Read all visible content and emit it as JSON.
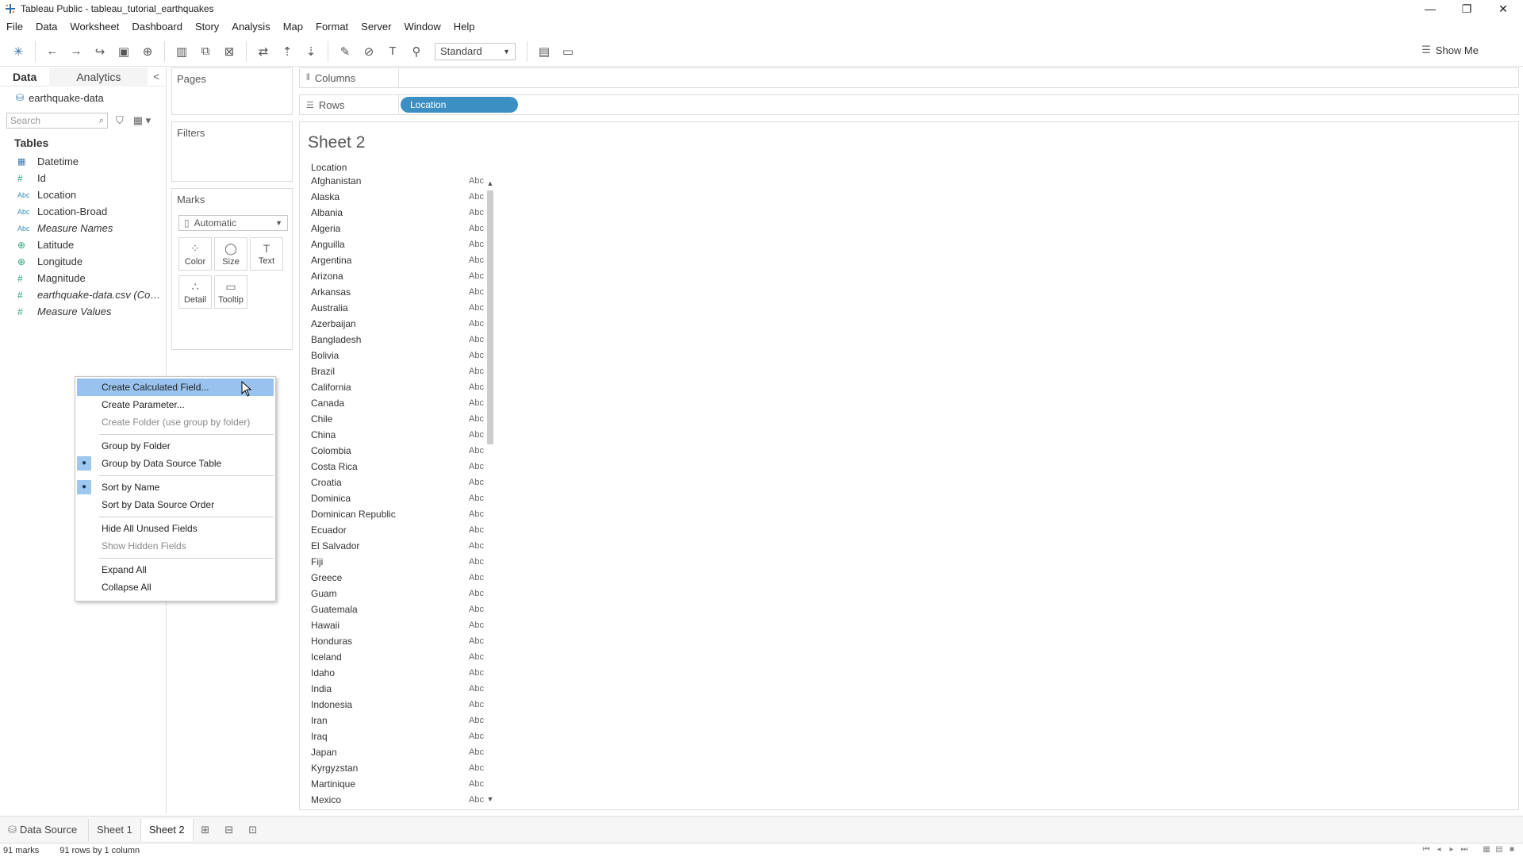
{
  "window": {
    "title": "Tableau Public - tableau_tutorial_earthquakes",
    "minimize": "—",
    "restore": "❐",
    "close": "✕"
  },
  "menu": [
    "File",
    "Data",
    "Worksheet",
    "Dashboard",
    "Story",
    "Analysis",
    "Map",
    "Format",
    "Server",
    "Window",
    "Help"
  ],
  "toolbar": {
    "fit_select": "Standard",
    "show_me": "Show Me"
  },
  "data_pane": {
    "tab_data": "Data",
    "tab_analytics": "Analytics",
    "collapse": "<",
    "datasource": "earthquake-data",
    "search_placeholder": "Search",
    "tables_header": "Tables",
    "fields": [
      {
        "type": "date",
        "glyph": "▦",
        "name": "Datetime",
        "italic": false
      },
      {
        "type": "num",
        "glyph": "#",
        "name": "Id",
        "italic": false
      },
      {
        "type": "str",
        "glyph": "Abc",
        "name": "Location",
        "italic": false
      },
      {
        "type": "str",
        "glyph": "Abc",
        "name": "Location-Broad",
        "italic": false
      },
      {
        "type": "str",
        "glyph": "Abc",
        "name": "Measure Names",
        "italic": true
      },
      {
        "type": "geo",
        "glyph": "⊕",
        "name": "Latitude",
        "italic": false
      },
      {
        "type": "geo",
        "glyph": "⊕",
        "name": "Longitude",
        "italic": false
      },
      {
        "type": "num",
        "glyph": "#",
        "name": "Magnitude",
        "italic": false
      },
      {
        "type": "num",
        "glyph": "#",
        "name": "earthquake-data.csv (Cou...",
        "italic": true
      },
      {
        "type": "num",
        "glyph": "#",
        "name": "Measure Values",
        "italic": true
      }
    ]
  },
  "cards": {
    "pages": "Pages",
    "filters": "Filters",
    "marks": "Marks",
    "marks_type": "Automatic",
    "mark_buttons": [
      {
        "label": "Color",
        "glyph": "⁘"
      },
      {
        "label": "Size",
        "glyph": "◯"
      },
      {
        "label": "Text",
        "glyph": "T"
      },
      {
        "label": "Detail",
        "glyph": "∴"
      },
      {
        "label": "Tooltip",
        "glyph": "▭"
      }
    ]
  },
  "shelves": {
    "columns": "Columns",
    "rows": "Rows",
    "rows_pill": "Location"
  },
  "view": {
    "sheet_title": "Sheet 2",
    "column_header": "Location",
    "abc": "Abc",
    "locations": [
      "Afghanistan",
      "Alaska",
      "Albania",
      "Algeria",
      "Anguilla",
      "Argentina",
      "Arizona",
      "Arkansas",
      "Australia",
      "Azerbaijan",
      "Bangladesh",
      "Bolivia",
      "Brazil",
      "California",
      "Canada",
      "Chile",
      "China",
      "Colombia",
      "Costa Rica",
      "Croatia",
      "Dominica",
      "Dominican Republic",
      "Ecuador",
      "El Salvador",
      "Fiji",
      "Greece",
      "Guam",
      "Guatemala",
      "Hawaii",
      "Honduras",
      "Iceland",
      "Idaho",
      "India",
      "Indonesia",
      "Iran",
      "Iraq",
      "Japan",
      "Kyrgyzstan",
      "Martinique",
      "Mexico"
    ]
  },
  "context_menu": [
    {
      "label": "Create Calculated Field...",
      "state": "highlight"
    },
    {
      "label": "Create Parameter...",
      "state": "normal"
    },
    {
      "label": "Create Folder (use group by folder)",
      "state": "disabled"
    },
    {
      "sep": true
    },
    {
      "label": "Group by Folder",
      "state": "normal"
    },
    {
      "label": "Group by Data Source Table",
      "state": "checked"
    },
    {
      "sep": true
    },
    {
      "label": "Sort by Name",
      "state": "checked"
    },
    {
      "label": "Sort by Data Source Order",
      "state": "normal"
    },
    {
      "sep": true
    },
    {
      "label": "Hide All Unused Fields",
      "state": "normal"
    },
    {
      "label": "Show Hidden Fields",
      "state": "disabled"
    },
    {
      "sep": true
    },
    {
      "label": "Expand All",
      "state": "normal"
    },
    {
      "label": "Collapse All",
      "state": "normal"
    }
  ],
  "sheet_tabs": {
    "data_source": "Data Source",
    "sheet1": "Sheet 1",
    "sheet2": "Sheet 2"
  },
  "status": {
    "marks": "91 marks",
    "rows_cols": "91 rows by 1 column"
  },
  "colors": {
    "pill": "#3b8fc2",
    "highlight": "#99c3ee"
  }
}
